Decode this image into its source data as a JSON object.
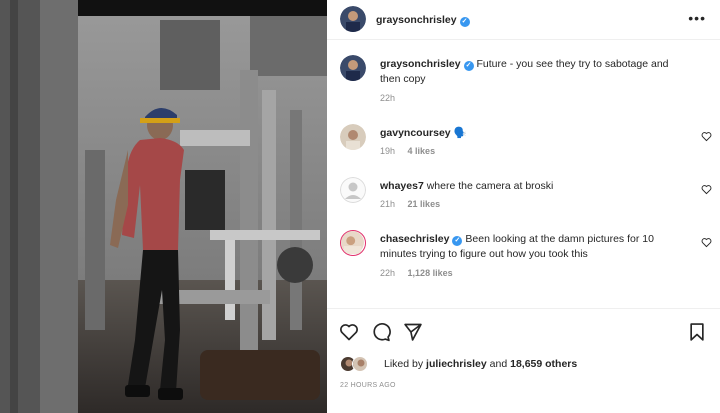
{
  "post": {
    "username": "graysonchrisley",
    "more_label": "•••"
  },
  "caption": {
    "username": "graysonchrisley",
    "text": "Future - you see they try to sabotage and then copy",
    "age": "22h"
  },
  "comments": [
    {
      "username": "gavyncoursey",
      "text": "",
      "emoji": "🗣️",
      "age": "19h",
      "likes": "4 likes",
      "verified": false
    },
    {
      "username": "whayes7",
      "text": "where the camera at broski",
      "age": "21h",
      "likes": "21 likes",
      "verified": false
    },
    {
      "username": "chasechrisley",
      "text": "Been looking at the damn pictures for 10 minutes trying to figure out how you took this",
      "age": "22h",
      "likes": "1,128 likes",
      "verified": true
    }
  ],
  "likes": {
    "prefix": "Liked by",
    "user": "juliechrisley",
    "joiner": "and",
    "others": "18,659 others"
  },
  "timestamp": "22 HOURS AGO",
  "colors": {
    "verified": "#3897f0",
    "meta": "#8e8e8e",
    "text": "#262626"
  },
  "icons": [
    "verified-badge-icon",
    "more-options-icon",
    "heart-icon",
    "comment-icon",
    "share-icon",
    "bookmark-icon"
  ]
}
